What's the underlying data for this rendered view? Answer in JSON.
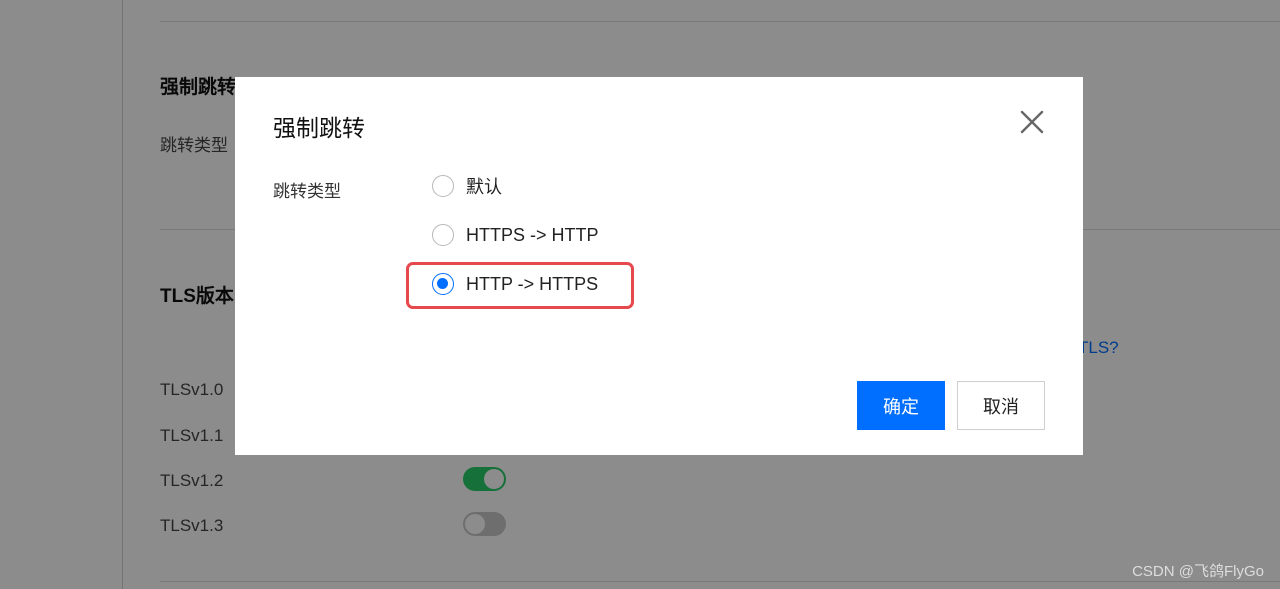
{
  "background": {
    "section1": {
      "title": "强制跳转",
      "label": "跳转类型"
    },
    "section2": {
      "title": "TLS版本",
      "link_text": "TLS?"
    },
    "tls_items": [
      {
        "label": "TLSv1.0"
      },
      {
        "label": "TLSv1.1"
      },
      {
        "label": "TLSv1.2",
        "enabled": true
      },
      {
        "label": "TLSv1.3",
        "enabled": false
      }
    ]
  },
  "dialog": {
    "title": "强制跳转",
    "field_label": "跳转类型",
    "options": [
      {
        "label": "默认",
        "selected": false
      },
      {
        "label": "HTTPS -> HTTP",
        "selected": false
      },
      {
        "label": "HTTP -> HTTPS",
        "selected": true
      }
    ],
    "confirm_label": "确定",
    "cancel_label": "取消"
  },
  "watermark": "CSDN @飞鸽FlyGo",
  "colors": {
    "primary": "#006eff",
    "highlight": "#e5484d",
    "toggle_on": "#29cc6a",
    "toggle_off": "#c8c8c8"
  }
}
